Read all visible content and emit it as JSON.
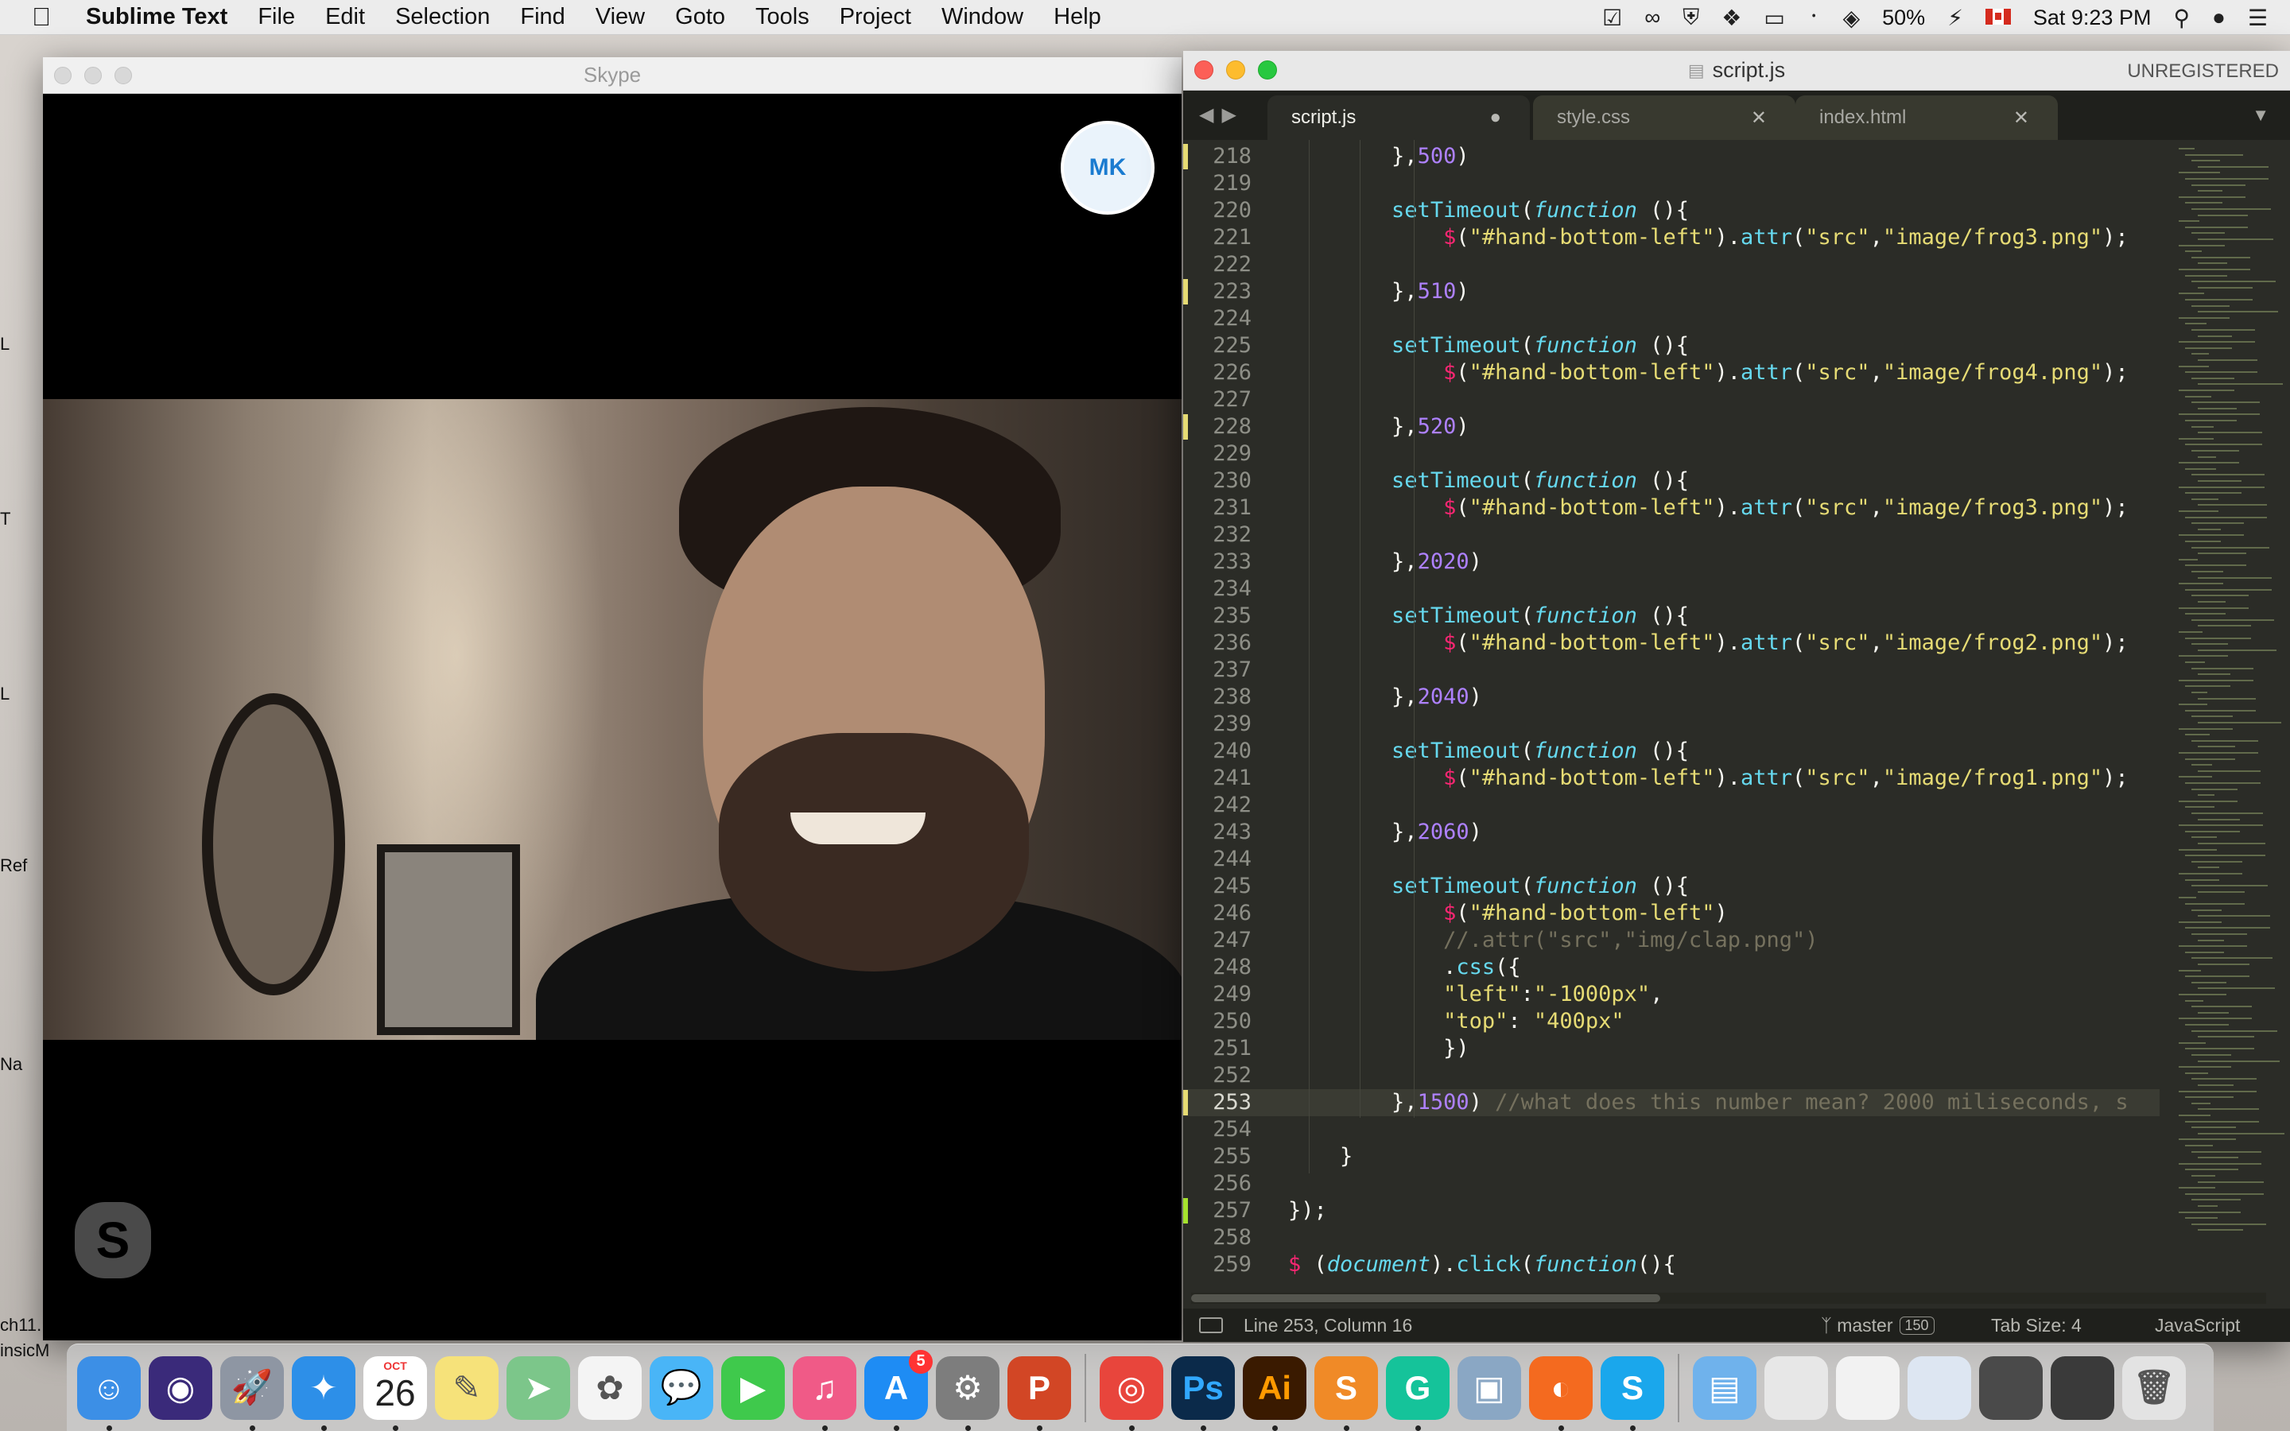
{
  "menubar": {
    "app_name": "Sublime Text",
    "items": [
      "File",
      "Edit",
      "Selection",
      "Find",
      "View",
      "Goto",
      "Tools",
      "Project",
      "Window",
      "Help"
    ],
    "battery": "50%",
    "clock": "Sat 9:23 PM"
  },
  "desktop_labels": [
    "L",
    "T",
    "L",
    "Ref",
    "Na",
    "ch11.",
    "insicM"
  ],
  "skype": {
    "title": "Skype",
    "avatar_initials": "MK",
    "logo_letter": "S"
  },
  "sublime": {
    "title": "script.js",
    "registration": "UNREGISTERED",
    "tabs": [
      {
        "label": "script.js",
        "mark": "●"
      },
      {
        "label": "style.css",
        "mark": "✕"
      },
      {
        "label": "index.html",
        "mark": "✕"
      }
    ],
    "code_lines": [
      {
        "n": "218",
        "code": "        },500)"
      },
      {
        "n": "219",
        "code": ""
      },
      {
        "n": "220",
        "code": "        setTimeout(function (){"
      },
      {
        "n": "221",
        "code": "            $(\"#hand-bottom-left\").attr(\"src\",\"image/frog3.png\");"
      },
      {
        "n": "222",
        "code": ""
      },
      {
        "n": "223",
        "code": "        },510)"
      },
      {
        "n": "224",
        "code": ""
      },
      {
        "n": "225",
        "code": "        setTimeout(function (){"
      },
      {
        "n": "226",
        "code": "            $(\"#hand-bottom-left\").attr(\"src\",\"image/frog4.png\");"
      },
      {
        "n": "227",
        "code": ""
      },
      {
        "n": "228",
        "code": "        },520)"
      },
      {
        "n": "229",
        "code": ""
      },
      {
        "n": "230",
        "code": "        setTimeout(function (){"
      },
      {
        "n": "231",
        "code": "            $(\"#hand-bottom-left\").attr(\"src\",\"image/frog3.png\");"
      },
      {
        "n": "232",
        "code": ""
      },
      {
        "n": "233",
        "code": "        },2020)"
      },
      {
        "n": "234",
        "code": ""
      },
      {
        "n": "235",
        "code": "        setTimeout(function (){"
      },
      {
        "n": "236",
        "code": "            $(\"#hand-bottom-left\").attr(\"src\",\"image/frog2.png\");"
      },
      {
        "n": "237",
        "code": ""
      },
      {
        "n": "238",
        "code": "        },2040)"
      },
      {
        "n": "239",
        "code": ""
      },
      {
        "n": "240",
        "code": "        setTimeout(function (){"
      },
      {
        "n": "241",
        "code": "            $(\"#hand-bottom-left\").attr(\"src\",\"image/frog1.png\");"
      },
      {
        "n": "242",
        "code": ""
      },
      {
        "n": "243",
        "code": "        },2060)"
      },
      {
        "n": "244",
        "code": ""
      },
      {
        "n": "245",
        "code": "        setTimeout(function (){"
      },
      {
        "n": "246",
        "code": "            $(\"#hand-bottom-left\")"
      },
      {
        "n": "247",
        "code": "            //.attr(\"src\",\"img/clap.png\")"
      },
      {
        "n": "248",
        "code": "            .css({"
      },
      {
        "n": "249",
        "code": "            \"left\":\"-1000px\","
      },
      {
        "n": "250",
        "code": "            \"top\": \"400px\""
      },
      {
        "n": "251",
        "code": "            })"
      },
      {
        "n": "252",
        "code": ""
      },
      {
        "n": "253",
        "code": "        },1500) //what does this number mean? 2000 miliseconds, s"
      },
      {
        "n": "254",
        "code": ""
      },
      {
        "n": "255",
        "code": "    }"
      },
      {
        "n": "256",
        "code": ""
      },
      {
        "n": "257",
        "code": "});"
      },
      {
        "n": "258",
        "code": ""
      },
      {
        "n": "259",
        "code": "$ (document).click(function(){"
      }
    ],
    "current_line": "253",
    "modified_lines": [
      "218",
      "223",
      "228",
      "253"
    ],
    "added_lines": [
      "257"
    ],
    "status": {
      "position": "Line 253, Column 16",
      "branch": "master",
      "branch_count": "150",
      "tab_size": "Tab Size: 4",
      "syntax": "JavaScript"
    }
  },
  "dock": {
    "calendar_month": "OCT",
    "calendar_day": "26",
    "app_store_badge": "5",
    "apps": [
      {
        "name": "finder",
        "glyph": "☺",
        "color": "#3c8fe6"
      },
      {
        "name": "siri",
        "glyph": "◉",
        "color": "#3a2a7a"
      },
      {
        "name": "launchpad",
        "glyph": "🚀",
        "color": "#8e96a3"
      },
      {
        "name": "safari",
        "glyph": "✦",
        "color": "#2d8fe8"
      },
      {
        "name": "calendar",
        "glyph": "",
        "color": "#ffffff"
      },
      {
        "name": "notes",
        "glyph": "✎",
        "color": "#f6e27a"
      },
      {
        "name": "maps",
        "glyph": "➤",
        "color": "#7cc68a"
      },
      {
        "name": "photos",
        "glyph": "✿",
        "color": "#f4f4f4"
      },
      {
        "name": "messages",
        "glyph": "💬",
        "color": "#49b5f7"
      },
      {
        "name": "facetime",
        "glyph": "▶",
        "color": "#3fc94c"
      },
      {
        "name": "itunes",
        "glyph": "♫",
        "color": "#f05a87"
      },
      {
        "name": "app-store",
        "glyph": "A",
        "color": "#1e8cf4"
      },
      {
        "name": "system-preferences",
        "glyph": "⚙",
        "color": "#7d7d7d"
      },
      {
        "name": "powerpoint",
        "glyph": "P",
        "color": "#d24625"
      },
      {
        "name": "chrome",
        "glyph": "◎",
        "color": "#e8453c"
      },
      {
        "name": "photoshop",
        "glyph": "Ps",
        "color": "#0b2a4a"
      },
      {
        "name": "illustrator",
        "glyph": "Ai",
        "color": "#3a1a00"
      },
      {
        "name": "sublime-text",
        "glyph": "S",
        "color": "#f08a27"
      },
      {
        "name": "grammarly",
        "glyph": "G",
        "color": "#15c39a"
      },
      {
        "name": "preview",
        "glyph": "▣",
        "color": "#8aa7c4"
      },
      {
        "name": "firefox",
        "glyph": "◐",
        "color": "#f46a1f"
      },
      {
        "name": "skype",
        "glyph": "S",
        "color": "#1aa7ec"
      },
      {
        "name": "downloads-folder",
        "glyph": "▤",
        "color": "#6fb2ec"
      },
      {
        "name": "window-thumb-1",
        "glyph": "",
        "color": "#e7e7e7"
      },
      {
        "name": "window-thumb-2",
        "glyph": "",
        "color": "#f2f2f2"
      },
      {
        "name": "window-thumb-3",
        "glyph": "",
        "color": "#dde6f2"
      },
      {
        "name": "window-thumb-4",
        "glyph": "",
        "color": "#4a4a4a"
      },
      {
        "name": "window-thumb-5",
        "glyph": "",
        "color": "#3a3a3a"
      },
      {
        "name": "trash",
        "glyph": "🗑",
        "color": "#e3e3e3"
      }
    ]
  }
}
